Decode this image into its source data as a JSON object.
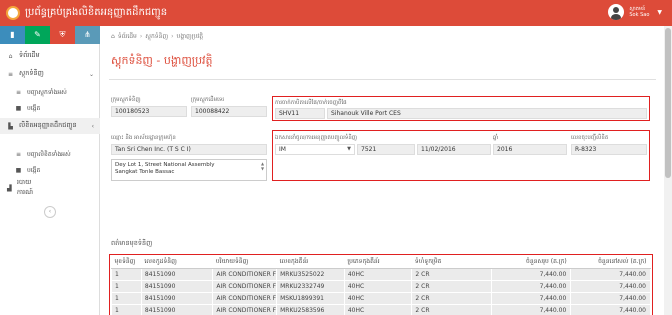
{
  "header": {
    "title": "ប្រព័ន្ធគ្រប់គ្រងលិខិតអនុញ្ញាតដឹកជញ្ជូន",
    "user_line1": "ស្វាគមន៍",
    "user_line2": "Sok Sao"
  },
  "toolbar": {
    "icons": [
      "chart-icon",
      "pencil-icon",
      "shield-icon",
      "share-icon"
    ],
    "glyphs": [
      "▮",
      "✎",
      "⛨",
      "⋔"
    ]
  },
  "sidebar": {
    "items": [
      {
        "icon": "⌂",
        "label": "ទំព័រដើម"
      },
      {
        "icon": "≡",
        "label": "ស្តុកទំនិញ",
        "chevron": "⌄"
      },
      {
        "icon": "≡",
        "label": "បញ្ជាស្តុកទាំងអស់"
      },
      {
        "icon": "■",
        "label": "បង្កើត"
      },
      {
        "icon": "▙",
        "label": "លិខិតអនុញ្ញាតដឹកជញ្ជូន",
        "chevron": "‹"
      },
      {
        "icon": "≡",
        "label": "បញ្ជាលិខិតទាំងអស់"
      },
      {
        "icon": "■",
        "label": "បង្កើត"
      },
      {
        "icon": "▟",
        "label": "របាយការណ៍"
      }
    ],
    "collapse_glyph": "‹"
  },
  "breadcrumb": [
    "ទំព័រដើម",
    "ស្តុកទំនិញ",
    "បង្ហាញប្រវត្តិ"
  ],
  "breadcrumb_sep": "›",
  "page_title": "ស្តុកទំនិញ - បង្ហាញប្រវត្តិ",
  "form": {
    "stock_no_label": "ក្រុមស្តុកទំនិញ",
    "stock_no": "100180523",
    "ref_label": "ក្រុមស្តុកដើមទេរ",
    "ref": "100088422",
    "port_label": "ការចាក់កាបិតាលើផែ/ចាក់ចេញពីផែ",
    "port_code": "SHV11",
    "port_name": "Sihanouk Ville Port CES",
    "company_label": "ឈ្មោះ និង អាស័យដ្ឋានក្រុមហ៊ុន",
    "company": "Tan Sri Chen Inc. (T S C I)",
    "address_line1": "Dey Lot 1, Street National Assembly",
    "address_line2": "Sangkat Tonle Bassac",
    "doc_label": "ឯកសារនាំចូល/ការអនុញ្ញាតបញ្ចូលទំនិញ",
    "doc_type": "IM",
    "doc_no": "7521",
    "doc_date": "11/02/2016",
    "year_label": "ឆ្នាំ",
    "year": "2016",
    "reg_label": "លេខចុះបញ្ជីលិខិត",
    "reg_no": "R-8323"
  },
  "items": {
    "section_title": "ពត៌មានមុខទំនិញ",
    "headers": [
      "មុខទំនិញ",
      "លេខកូដទំនិញ",
      "បរិយាយទំនិញ",
      "លេខកុងតឺន័រ",
      "ប្រភេទកុងតឺន័រ",
      "ទំហំទូកម្រិត",
      "ចំនួនសរុប (គ.ក្រ)",
      "ចំនួននៅសល់ (គ.ក្រ)"
    ],
    "rows": [
      [
        "1",
        "84151090",
        "AIR CONDITIONER F",
        "MRKU3525022",
        "40HC",
        "2 CR",
        "7,440.00",
        "7,440.00"
      ],
      [
        "1",
        "84151090",
        "AIR CONDITIONER F",
        "MRKU2332749",
        "40HC",
        "2 CR",
        "7,440.00",
        "7,440.00"
      ],
      [
        "1",
        "84151090",
        "AIR CONDITIONER F",
        "MSKU1899391",
        "40HC",
        "2 CR",
        "7,440.00",
        "7,440.00"
      ],
      [
        "1",
        "84151090",
        "AIR CONDITIONER F",
        "MRKU2583596",
        "40HC",
        "2 CR",
        "7,440.00",
        "7,440.00"
      ]
    ]
  },
  "colors": {
    "brand": "#dd4b39",
    "highlight_border": "#e02020"
  }
}
